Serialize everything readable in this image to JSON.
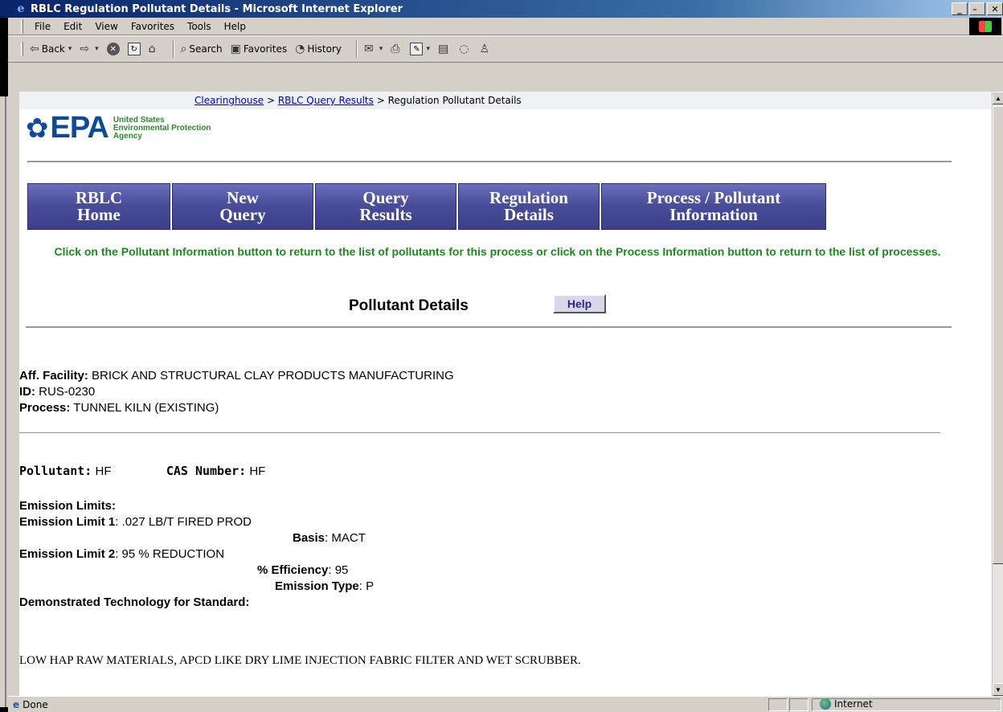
{
  "window": {
    "title": "RBLC Regulation Pollutant Details - Microsoft Internet Explorer",
    "controls": [
      "_",
      "̵",
      "✕"
    ]
  },
  "menubar": {
    "items": [
      "File",
      "Edit",
      "View",
      "Favorites",
      "Tools",
      "Help"
    ]
  },
  "toolbar": {
    "back": "Back",
    "search": "Search",
    "favorites": "Favorites",
    "history": "History"
  },
  "breadcrumb": {
    "link1": "Clearinghouse",
    "sep1": " > ",
    "link2": "RBLC Query Results",
    "sep2": " > ",
    "current": "Regulation Pollutant Details"
  },
  "logo": {
    "text": "EPA",
    "line1": "United States",
    "line2": "Environmental Protection",
    "line3": "Agency"
  },
  "nav": {
    "buttons": [
      {
        "label": "RBLC\nHome"
      },
      {
        "label": "New\nQuery"
      },
      {
        "label": "Query\nResults"
      },
      {
        "label": "Regulation\nDetails"
      },
      {
        "label": "Process / Pollutant\nInformation"
      }
    ]
  },
  "note": "Click on the Pollutant Information button to return to the list of pollutants for this process or click on the Process Information button to return to the list of processes.",
  "details": {
    "heading": "Pollutant Details",
    "help": "Help",
    "aff_facility_label": "Aff. Facility:",
    "aff_facility": "BRICK AND STRUCTURAL CLAY PRODUCTS MANUFACTURING",
    "id_label": "ID:",
    "id": "RUS-0230",
    "process_label": "Process:",
    "process": "TUNNEL KILN (EXISTING)",
    "pollutant_label": "Pollutant:",
    "pollutant": "HF",
    "cas_label": "CAS Number:",
    "cas": "HF",
    "emission_limits_label": "Emission Limits:",
    "limit1_label": "Emission Limit 1",
    "limit1": ": .027 LB/T FIRED PROD",
    "basis_label": "Basis",
    "basis": ": MACT",
    "limit2_label": "Emission Limit 2",
    "limit2": ": 95 % REDUCTION",
    "efficiency_label": "% Efficiency",
    "efficiency": ": 95",
    "emission_type_label": "Emission Type",
    "emission_type": ": P",
    "demo_tech_label": "Demonstrated Technology for Standard:",
    "demo_tech": "LOW HAP RAW MATERIALS, APCD LIKE DRY LIME INJECTION FABRIC FILTER AND WET SCRUBBER."
  },
  "status": {
    "text": "Done",
    "zone": "Internet"
  },
  "colors": {
    "note_green": "#1a8a1a",
    "epa_blue": "#0b4b9a",
    "nav_purple": "#4a4d9a",
    "link_blue": "#0000cc"
  }
}
